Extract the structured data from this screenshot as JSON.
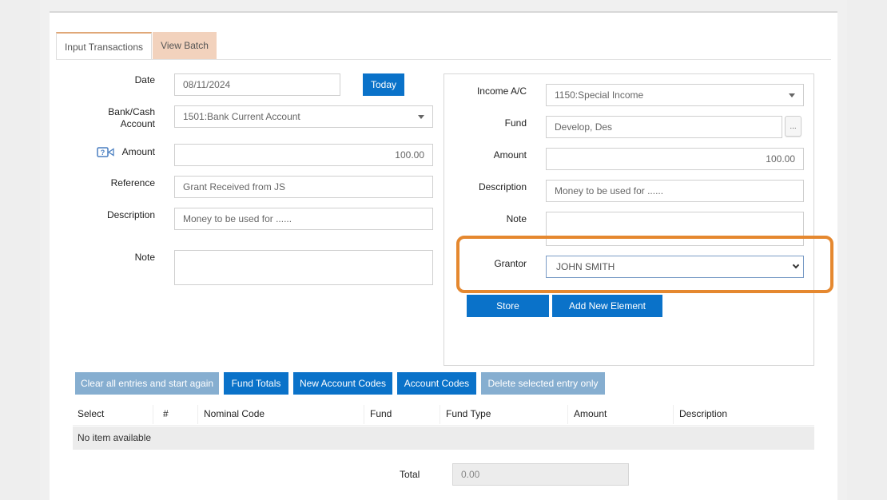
{
  "tabs": {
    "input_transactions": "Input Transactions",
    "view_batch": "View Batch"
  },
  "left_form": {
    "date_label": "Date",
    "date_value": "08/11/2024",
    "today_button": "Today",
    "bank_label_line1": "Bank/Cash",
    "bank_label_line2": "Account",
    "bank_value": "1501:Bank Current Account",
    "amount_label": "Amount",
    "amount_value": "100.00",
    "reference_label": "Reference",
    "reference_value": "Grant Received from JS",
    "description_label": "Description",
    "description_value": "Money to be used for ......",
    "note_label": "Note",
    "note_value": ""
  },
  "right_form": {
    "income_label": "Income A/C",
    "income_value": "1150:Special Income",
    "fund_label": "Fund",
    "fund_value": "Develop, Des",
    "fund_lookup_button": "...",
    "amount_label": "Amount",
    "amount_value": "100.00",
    "description_label": "Description",
    "description_value": "Money to be used for ......",
    "note_label": "Note",
    "note_value": "",
    "grantor_label": "Grantor",
    "grantor_value": "JOHN SMITH",
    "store_button": "Store",
    "add_element_button": "Add New Element"
  },
  "actions": {
    "clear_all": "Clear all entries and start again",
    "fund_totals": "Fund Totals",
    "new_account_codes": "New Account Codes",
    "account_codes": "Account Codes",
    "delete_selected": "Delete selected entry only"
  },
  "table": {
    "columns": [
      "Select",
      "#",
      "Nominal Code",
      "Fund",
      "Fund Type",
      "Amount",
      "Description"
    ],
    "empty_message": "No item available"
  },
  "total": {
    "label": "Total",
    "value": "0.00"
  },
  "colors": {
    "accent_blue": "#0a72c9",
    "faded_blue": "#86aed0",
    "highlight_orange": "#e5882f",
    "inactive_tab": "#f2d2bd"
  }
}
